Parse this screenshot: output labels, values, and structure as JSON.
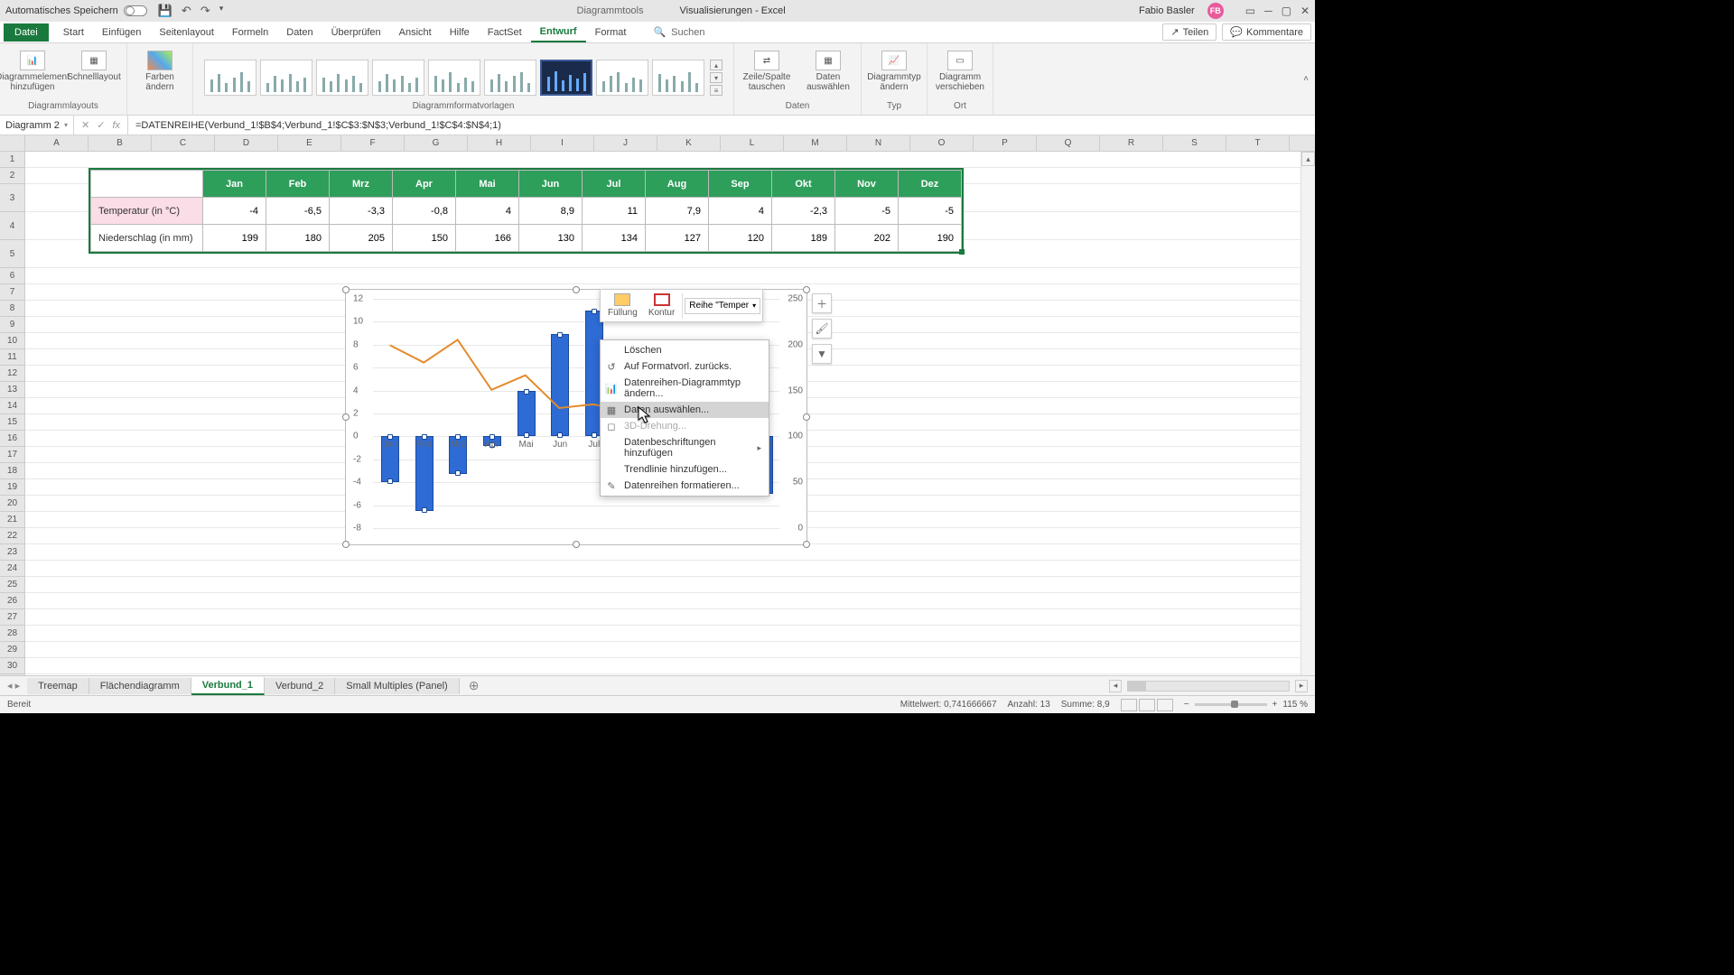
{
  "titlebar": {
    "autosave": "Automatisches Speichern",
    "chart_tools": "Diagrammtools",
    "filename": "Visualisierungen - Excel",
    "user": "Fabio Basler",
    "user_initials": "FB"
  },
  "tabs": {
    "file": "Datei",
    "list": [
      "Start",
      "Einfügen",
      "Seitenlayout",
      "Formeln",
      "Daten",
      "Überprüfen",
      "Ansicht",
      "Hilfe",
      "FactSet",
      "Entwurf",
      "Format"
    ],
    "active": "Entwurf",
    "search": "Suchen",
    "share": "Teilen",
    "comments": "Kommentare"
  },
  "ribbon": {
    "g1": {
      "btn1": "Diagrammelement hinzufügen",
      "btn2": "Schnelllayout",
      "label": "Diagrammlayouts"
    },
    "g2": {
      "btn": "Farben ändern"
    },
    "g3": {
      "label": "Diagrammformatvorlagen"
    },
    "g4": {
      "btn1": "Zeile/Spalte tauschen",
      "btn2": "Daten auswählen",
      "label": "Daten"
    },
    "g5": {
      "btn": "Diagrammtyp ändern",
      "label": "Typ"
    },
    "g6": {
      "btn": "Diagramm verschieben",
      "label": "Ort"
    }
  },
  "fbar": {
    "name": "Diagramm 2",
    "formula": "=DATENREIHE(Verbund_1!$B$4;Verbund_1!$C$3:$N$3;Verbund_1!$C$4:$N$4;1)"
  },
  "columns": [
    "A",
    "B",
    "C",
    "D",
    "E",
    "F",
    "G",
    "H",
    "I",
    "J",
    "K",
    "L",
    "M",
    "N",
    "O",
    "P",
    "Q",
    "R",
    "S",
    "T"
  ],
  "table": {
    "row_temp": "Temperatur (in °C)",
    "row_precip": "Niederschlag (in mm)",
    "months": [
      "Jan",
      "Feb",
      "Mrz",
      "Apr",
      "Mai",
      "Jun",
      "Jul",
      "Aug",
      "Sep",
      "Okt",
      "Nov",
      "Dez"
    ],
    "temp": [
      "-4",
      "-6,5",
      "-3,3",
      "-0,8",
      "4",
      "8,9",
      "11",
      "7,9",
      "4",
      "-2,3",
      "-5",
      "-5"
    ],
    "precip": [
      "199",
      "180",
      "205",
      "150",
      "166",
      "130",
      "134",
      "127",
      "120",
      "189",
      "202",
      "190"
    ]
  },
  "chart_data": {
    "type": "combo",
    "categories": [
      "Jan",
      "Feb",
      "Mrz",
      "Apr",
      "Mai",
      "Jun",
      "Jul",
      "Aug",
      "Sep",
      "Okt",
      "Nov",
      "Dez"
    ],
    "series": [
      {
        "name": "Temperatur (in °C)",
        "type": "bar",
        "axis": "primary",
        "values": [
          -4,
          -6.5,
          -3.3,
          -0.8,
          4,
          8.9,
          11,
          7.9,
          4,
          -2.3,
          -5,
          -5
        ]
      },
      {
        "name": "Niederschlag (in mm)",
        "type": "line",
        "axis": "secondary",
        "values": [
          199,
          180,
          205,
          150,
          166,
          130,
          134,
          127,
          120,
          189,
          202,
          190
        ]
      }
    ],
    "ylim": [
      -8,
      12
    ],
    "y2lim": [
      0,
      250
    ],
    "yticks": [
      -8,
      -6,
      -4,
      -2,
      0,
      2,
      4,
      6,
      8,
      10,
      12
    ],
    "y2ticks": [
      0,
      50,
      100,
      150,
      200,
      250
    ]
  },
  "minitoolbar": {
    "fill": "Füllung",
    "outline": "Kontur",
    "series": "Reihe \"Temper"
  },
  "context_menu": {
    "delete": "Löschen",
    "reset": "Auf Formatvorl. zurücks.",
    "change_type": "Datenreihen-Diagrammtyp ändern...",
    "select_data": "Daten auswählen...",
    "rotate3d": "3D-Drehung...",
    "add_labels": "Datenbeschriftungen hinzufügen",
    "add_trend": "Trendlinie hinzufügen...",
    "format": "Datenreihen formatieren..."
  },
  "sheets": {
    "list": [
      "Treemap",
      "Flächendiagramm",
      "Verbund_1",
      "Verbund_2",
      "Small Multiples (Panel)"
    ],
    "active": "Verbund_1"
  },
  "status": {
    "ready": "Bereit",
    "avg": "Mittelwert: 0,741666667",
    "count": "Anzahl: 13",
    "sum": "Summe: 8,9",
    "zoom": "115 %"
  }
}
